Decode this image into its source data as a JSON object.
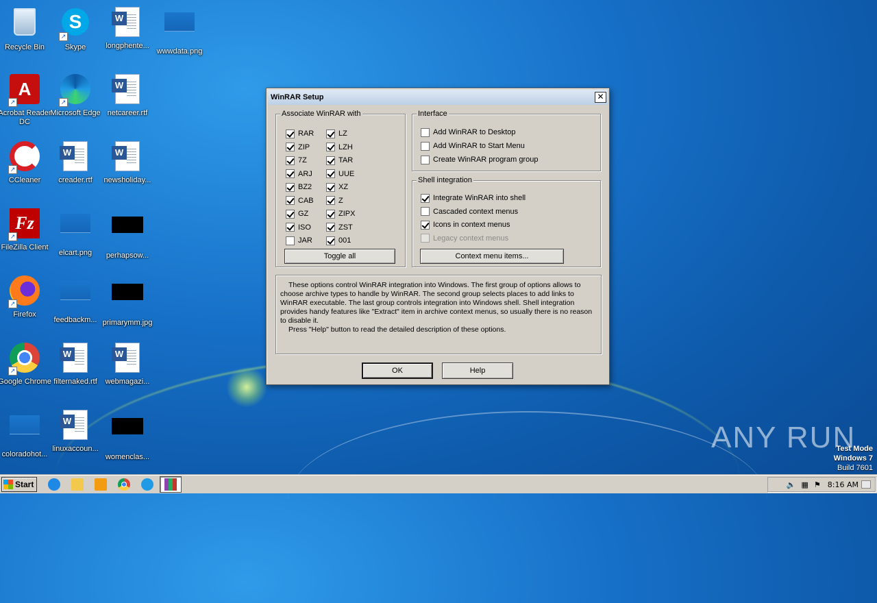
{
  "desktop": {
    "icons": [
      {
        "label": "Recycle Bin",
        "icon": "recycle-bin-icon"
      },
      {
        "label": "Skype",
        "icon": "skype-icon"
      },
      {
        "label": "longphente...",
        "icon": "word-doc-icon"
      },
      {
        "label": "wwwdata.png",
        "icon": "image-file-icon"
      },
      {
        "label": "Acrobat Reader DC",
        "icon": "acrobat-icon"
      },
      {
        "label": "Microsoft Edge",
        "icon": "edge-icon"
      },
      {
        "label": "netcareer.rtf",
        "icon": "word-doc-icon"
      },
      {
        "label": "CCleaner",
        "icon": "ccleaner-icon"
      },
      {
        "label": "creader.rtf",
        "icon": "word-doc-icon"
      },
      {
        "label": "newsholiday...",
        "icon": "word-doc-icon"
      },
      {
        "label": "FileZilla Client",
        "icon": "filezilla-icon"
      },
      {
        "label": "elcart.png",
        "icon": "image-file-icon"
      },
      {
        "label": "perhapsow...",
        "icon": "black-thumbnail-icon"
      },
      {
        "label": "Firefox",
        "icon": "firefox-icon"
      },
      {
        "label": "feedbackm...",
        "icon": "image-file-icon"
      },
      {
        "label": "primarymm.jpg",
        "icon": "black-thumbnail-icon"
      },
      {
        "label": "Google Chrome",
        "icon": "chrome-icon"
      },
      {
        "label": "filternaked.rtf",
        "icon": "word-doc-icon"
      },
      {
        "label": "webmagazi...",
        "icon": "word-doc-icon"
      },
      {
        "label": "coloradohot...",
        "icon": "image-file-icon"
      },
      {
        "label": "linuxaccoun...",
        "icon": "word-doc-icon"
      },
      {
        "label": "womenclas...",
        "icon": "black-thumbnail-icon"
      }
    ]
  },
  "dialog": {
    "title": "WinRAR Setup",
    "associate": {
      "title": "Associate WinRAR with",
      "left": [
        {
          "label": "RAR",
          "checked": true
        },
        {
          "label": "ZIP",
          "checked": true
        },
        {
          "label": "7Z",
          "checked": true
        },
        {
          "label": "ARJ",
          "checked": true
        },
        {
          "label": "BZ2",
          "checked": true
        },
        {
          "label": "CAB",
          "checked": true
        },
        {
          "label": "GZ",
          "checked": true
        },
        {
          "label": "ISO",
          "checked": true
        },
        {
          "label": "JAR",
          "checked": false
        }
      ],
      "right": [
        {
          "label": "LZ",
          "checked": true
        },
        {
          "label": "LZH",
          "checked": true
        },
        {
          "label": "TAR",
          "checked": true
        },
        {
          "label": "UUE",
          "checked": true
        },
        {
          "label": "XZ",
          "checked": true
        },
        {
          "label": "Z",
          "checked": true
        },
        {
          "label": "ZIPX",
          "checked": true
        },
        {
          "label": "ZST",
          "checked": true
        },
        {
          "label": "001",
          "checked": true
        }
      ],
      "toggle_all": "Toggle all"
    },
    "interface": {
      "title": "Interface",
      "items": [
        {
          "label": "Add WinRAR to Desktop",
          "checked": false
        },
        {
          "label": "Add WinRAR to Start Menu",
          "checked": false
        },
        {
          "label": "Create WinRAR program group",
          "checked": false
        }
      ]
    },
    "shell": {
      "title": "Shell integration",
      "items": [
        {
          "label": "Integrate WinRAR into shell",
          "checked": true,
          "disabled": false
        },
        {
          "label": "Cascaded context menus",
          "checked": false,
          "disabled": false
        },
        {
          "label": "Icons in context menus",
          "checked": true,
          "disabled": false
        },
        {
          "label": "Legacy context menus",
          "checked": false,
          "disabled": true
        }
      ],
      "context_button": "Context menu items..."
    },
    "description": [
      "These options control WinRAR integration into Windows. The first group of options allows to choose archive types to handle by WinRAR. The second group selects places to add links to WinRAR executable. The last group controls integration into Windows shell. Shell integration provides handy features like \"Extract\" item in archive context menus, so usually there is no reason to disable it.",
      "Press \"Help\" button to read the detailed description of these options."
    ],
    "ok": "OK",
    "help": "Help"
  },
  "taskbar": {
    "start": "Start",
    "pinned": [
      "ie-icon",
      "explorer-icon",
      "media-player-icon",
      "chrome-icon",
      "edge-icon",
      "winrar-icon"
    ],
    "clock": "8:16 AM"
  },
  "watermark": "ANY RUN",
  "test_mode": {
    "line1": "Test Mode",
    "line2": "Windows 7",
    "line3": "Build 7601"
  }
}
